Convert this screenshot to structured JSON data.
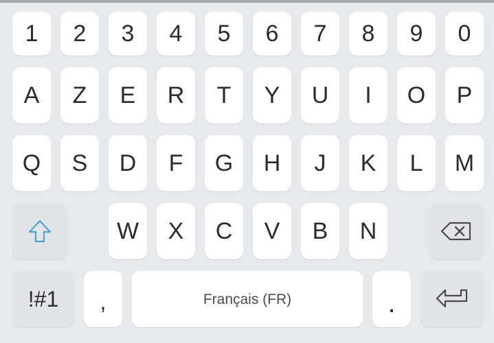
{
  "keyboard": {
    "row1": [
      "1",
      "2",
      "3",
      "4",
      "5",
      "6",
      "7",
      "8",
      "9",
      "0"
    ],
    "row2": [
      "A",
      "Z",
      "E",
      "R",
      "T",
      "Y",
      "U",
      "I",
      "O",
      "P"
    ],
    "row3": [
      "Q",
      "S",
      "D",
      "F",
      "G",
      "H",
      "J",
      "K",
      "L",
      "M"
    ],
    "row4": [
      "W",
      "X",
      "C",
      "V",
      "B",
      "N"
    ],
    "symbols_label": "!#1",
    "comma_label": ",",
    "space_label": "Français (FR)",
    "period_label": ".",
    "icons": {
      "shift": "shift-arrow-icon",
      "backspace": "backspace-icon",
      "enter": "enter-icon"
    },
    "colors": {
      "background": "#e8e9ec",
      "key": "#ffffff",
      "function_key": "#e1e3e7",
      "shift_accent": "#4aa5d6"
    }
  }
}
